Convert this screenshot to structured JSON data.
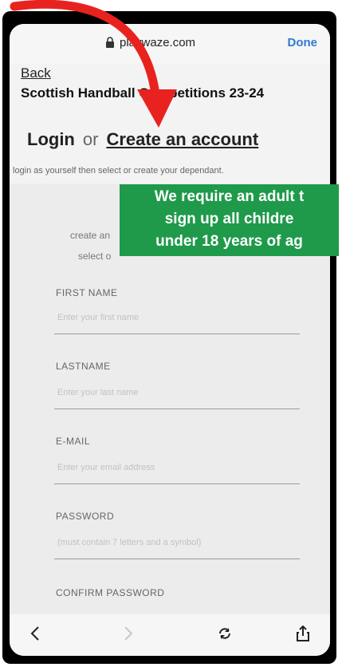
{
  "browser": {
    "url": "playwaze.com",
    "done_label": "Done"
  },
  "page": {
    "back_label": "Back",
    "title": "Scottish Handball Competitions 23-24",
    "login_label": "Login",
    "or_label": "or",
    "create_label": "Create an account",
    "hint": "login as yourself then select or create your dependant."
  },
  "form": {
    "sub_line_1": "create an",
    "sub_line_2": "select o",
    "fields": [
      {
        "label": "FIRST NAME",
        "placeholder": "Enter your first name"
      },
      {
        "label": "LASTNAME",
        "placeholder": "Enter your last name"
      },
      {
        "label": "E-MAIL",
        "placeholder": "Enter your email address"
      },
      {
        "label": "PASSWORD",
        "placeholder": "(must contain 7 letters and a symbol)"
      },
      {
        "label": "CONFIRM PASSWORD",
        "placeholder": ""
      }
    ]
  },
  "banner": {
    "line1": "We require an adult t",
    "line2": "sign up all childre",
    "line3": "under 18 years of ag"
  },
  "toolbar": {
    "back_icon": "chevron-left-icon",
    "forward_icon": "chevron-right-icon",
    "reload_icon": "reload-icon",
    "share_icon": "share-icon"
  },
  "colors": {
    "banner": "#1f9a4a",
    "done": "#2f79d4",
    "arrow": "#e8231f"
  }
}
